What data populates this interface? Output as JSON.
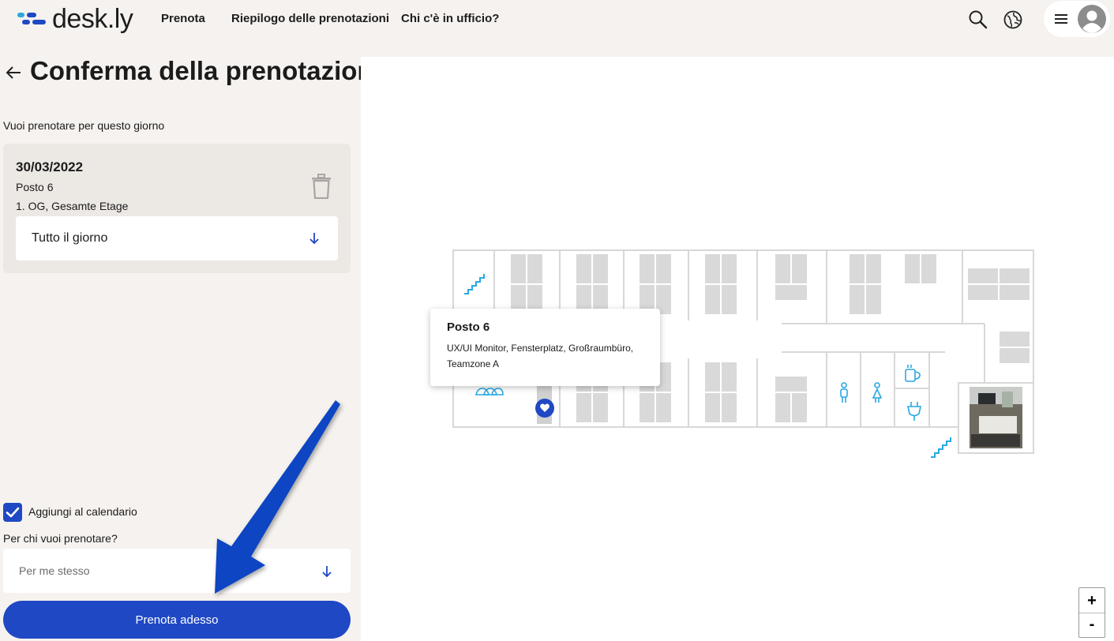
{
  "header": {
    "logo": "desk.ly",
    "nav": [
      "Prenota",
      "Riepilogo delle prenotazioni",
      "Chi c'è in ufficio?"
    ],
    "icons": [
      "search-icon",
      "globe-icon",
      "menu-icon",
      "avatar-icon"
    ]
  },
  "page": {
    "title": "Conferma della prenotazione",
    "subtitle": "Vuoi prenotare per questo giorno"
  },
  "booking": {
    "date": "30/03/2022",
    "seat": "Posto 6",
    "floor": "1. OG, Gesamte Etage",
    "time_option": "Tutto il giorno"
  },
  "calendar": {
    "label": "Aggiungi al calendario",
    "checked": true
  },
  "for_whom": {
    "label": "Per chi vuoi prenotare?",
    "placeholder": "Per me stesso"
  },
  "book_button": "Prenota adesso",
  "tooltip": {
    "title": "Posto 6",
    "description": "UX/UI Monitor, Fensterplatz, Großraumbüro, Teamzone A"
  },
  "zoom": {
    "in": "+",
    "out": "-"
  },
  "colors": {
    "accent": "#1f48c4",
    "map_icon": "#29a8e0",
    "background": "#f5f2ef",
    "card": "#ece8e4"
  }
}
